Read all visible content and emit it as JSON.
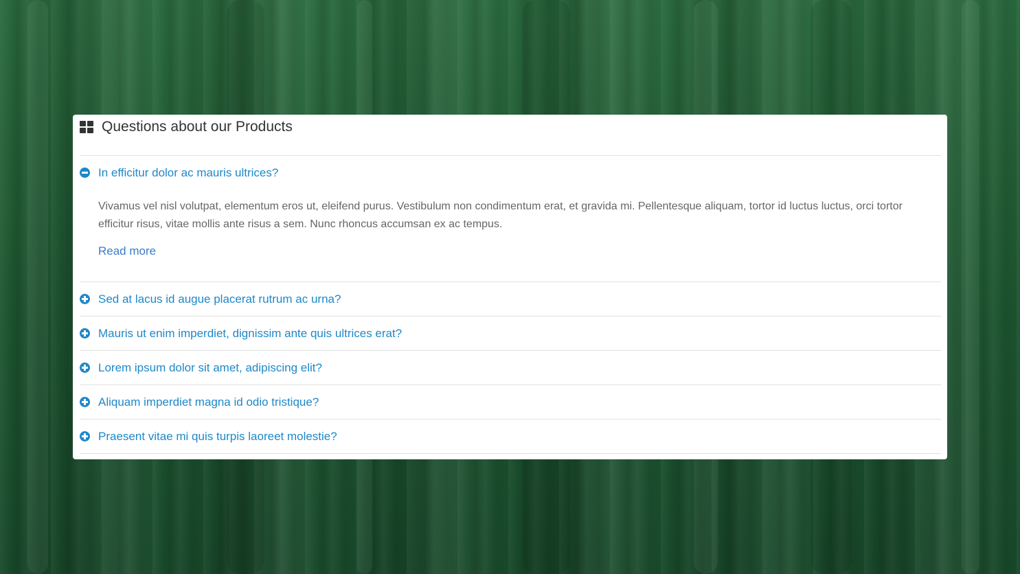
{
  "panel": {
    "title": "Questions about our Products",
    "title_icon": "grid-icon"
  },
  "faq": [
    {
      "question": "In efficitur dolor ac mauris ultrices?",
      "expanded": true,
      "icon": "minus-circle-icon",
      "answer": "Vivamus vel nisl volutpat, elementum eros ut, eleifend purus. Vestibulum non condimentum erat, et gravida mi. Pellentesque aliquam, tortor id luctus luctus, orci tortor efficitur risus, vitae mollis ante risus a sem. Nunc rhoncus accumsan ex ac tempus.",
      "link_label": "Read more"
    },
    {
      "question": "Sed at lacus id augue placerat rutrum ac urna?",
      "expanded": false,
      "icon": "plus-circle-icon"
    },
    {
      "question": "Mauris ut enim imperdiet, dignissim ante quis ultrices erat?",
      "expanded": false,
      "icon": "plus-circle-icon"
    },
    {
      "question": "Lorem ipsum dolor sit amet, adipiscing elit?",
      "expanded": false,
      "icon": "plus-circle-icon"
    },
    {
      "question": "Aliquam imperdiet magna id odio tristique?",
      "expanded": false,
      "icon": "plus-circle-icon"
    },
    {
      "question": "Praesent vitae mi quis turpis laoreet molestie?",
      "expanded": false,
      "icon": "plus-circle-icon"
    }
  ],
  "colors": {
    "accent": "#1e88c8",
    "background": "#1f5a34",
    "answer_text": "#666666",
    "title_text": "#333333"
  }
}
